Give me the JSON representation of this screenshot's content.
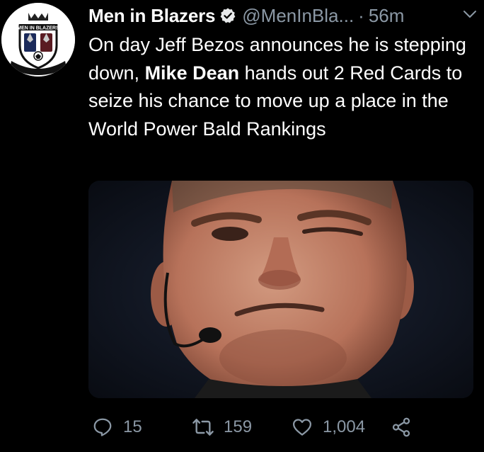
{
  "tweet": {
    "avatar_alt": "MEN IN BLAZERS",
    "display_name": "Men in Blazers",
    "handle": "@MenInBla...",
    "separator": "·",
    "time": "56m",
    "text": {
      "part1": "On day Jeff Bezos announces he is stepping down, ",
      "bold": "Mike Dean",
      "part2": " hands out 2 Red Cards to seize his chance to move up a place in the World Power Bald Rankings"
    },
    "actions": {
      "replies": "15",
      "retweets": "159",
      "likes": "1,004"
    }
  },
  "icons": {
    "verified": "verified-badge-icon",
    "more": "chevron-down-icon",
    "reply": "reply-icon",
    "retweet": "retweet-icon",
    "like": "heart-icon",
    "share": "share-icon"
  },
  "colors": {
    "background": "#000000",
    "text": "#ffffff",
    "muted": "#8b98a5"
  }
}
